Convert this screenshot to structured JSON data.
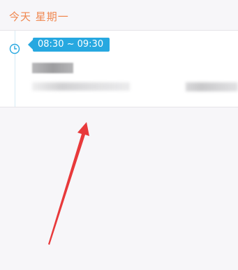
{
  "header": {
    "title": "今天 星期一"
  },
  "event": {
    "time_range": "08:30 ~ 09:30",
    "icon": "clock-icon",
    "title_redacted": true,
    "details_redacted": true
  },
  "colors": {
    "header_text": "#f0874f",
    "badge_bg": "#27a8e0",
    "annotation_arrow": "#e8393b"
  }
}
